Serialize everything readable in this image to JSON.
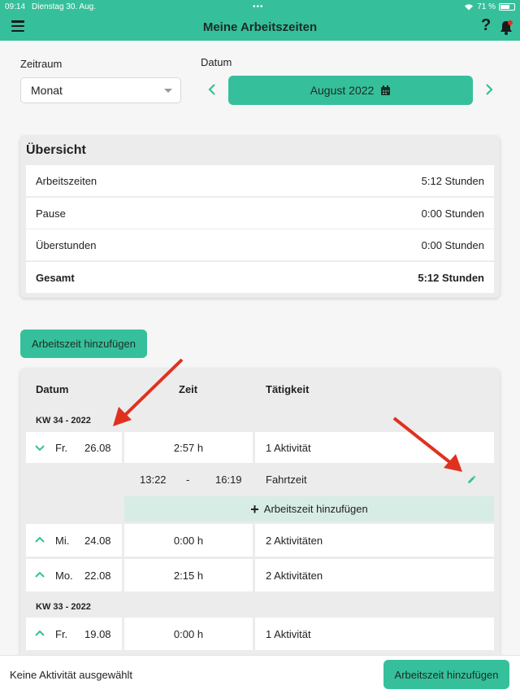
{
  "status_bar": {
    "time": "09:14",
    "date": "Dienstag 30. Aug.",
    "battery_text": "71 %"
  },
  "header": {
    "title": "Meine Arbeitszeiten",
    "help_label": "?",
    "icons": [
      "menu-icon",
      "help-icon",
      "bell-icon"
    ]
  },
  "filters": {
    "zeitraum_label": "Zeitraum",
    "zeitraum_value": "Monat",
    "datum_label": "Datum",
    "datum_value": "August 2022"
  },
  "overview": {
    "title": "Übersicht",
    "rows": [
      {
        "label": "Arbeitszeiten",
        "value": "5:12 Stunden"
      },
      {
        "label": "Pause",
        "value": "0:00 Stunden"
      },
      {
        "label": "Überstunden",
        "value": "0:00 Stunden"
      },
      {
        "label": "Gesamt",
        "value": "5:12 Stunden"
      }
    ]
  },
  "add_button_label": "Arbeitszeit hinzufügen",
  "table": {
    "headers": {
      "date": "Datum",
      "time": "Zeit",
      "activity": "Tätigkeit"
    },
    "week1": "KW 34 - 2022",
    "week2": "KW 33 - 2022",
    "rows": [
      {
        "weekday": "Fr.",
        "date": "26.08",
        "duration": "2:57 h",
        "activity": "1 Aktivität"
      },
      {
        "weekday": "Mi.",
        "date": "24.08",
        "duration": "0:00 h",
        "activity": "2 Aktivitäten"
      },
      {
        "weekday": "Mo.",
        "date": "22.08",
        "duration": "2:15 h",
        "activity": "2 Aktivitäten"
      },
      {
        "weekday": "Fr.",
        "date": "19.08",
        "duration": "0:00 h",
        "activity": "1 Aktivität"
      }
    ],
    "detail": {
      "start": "13:22",
      "sep": "-",
      "end": "16:19",
      "activity": "Fahrtzeit"
    },
    "add_inline_label": "Arbeitszeit hinzufügen"
  },
  "bottom": {
    "message": "Keine Aktivität ausgewählt",
    "button_label": "Arbeitszeit hinzufügen"
  },
  "colors": {
    "accent": "#35c09b",
    "light_accent": "#d7ece5",
    "annotation": "#e0311f"
  }
}
